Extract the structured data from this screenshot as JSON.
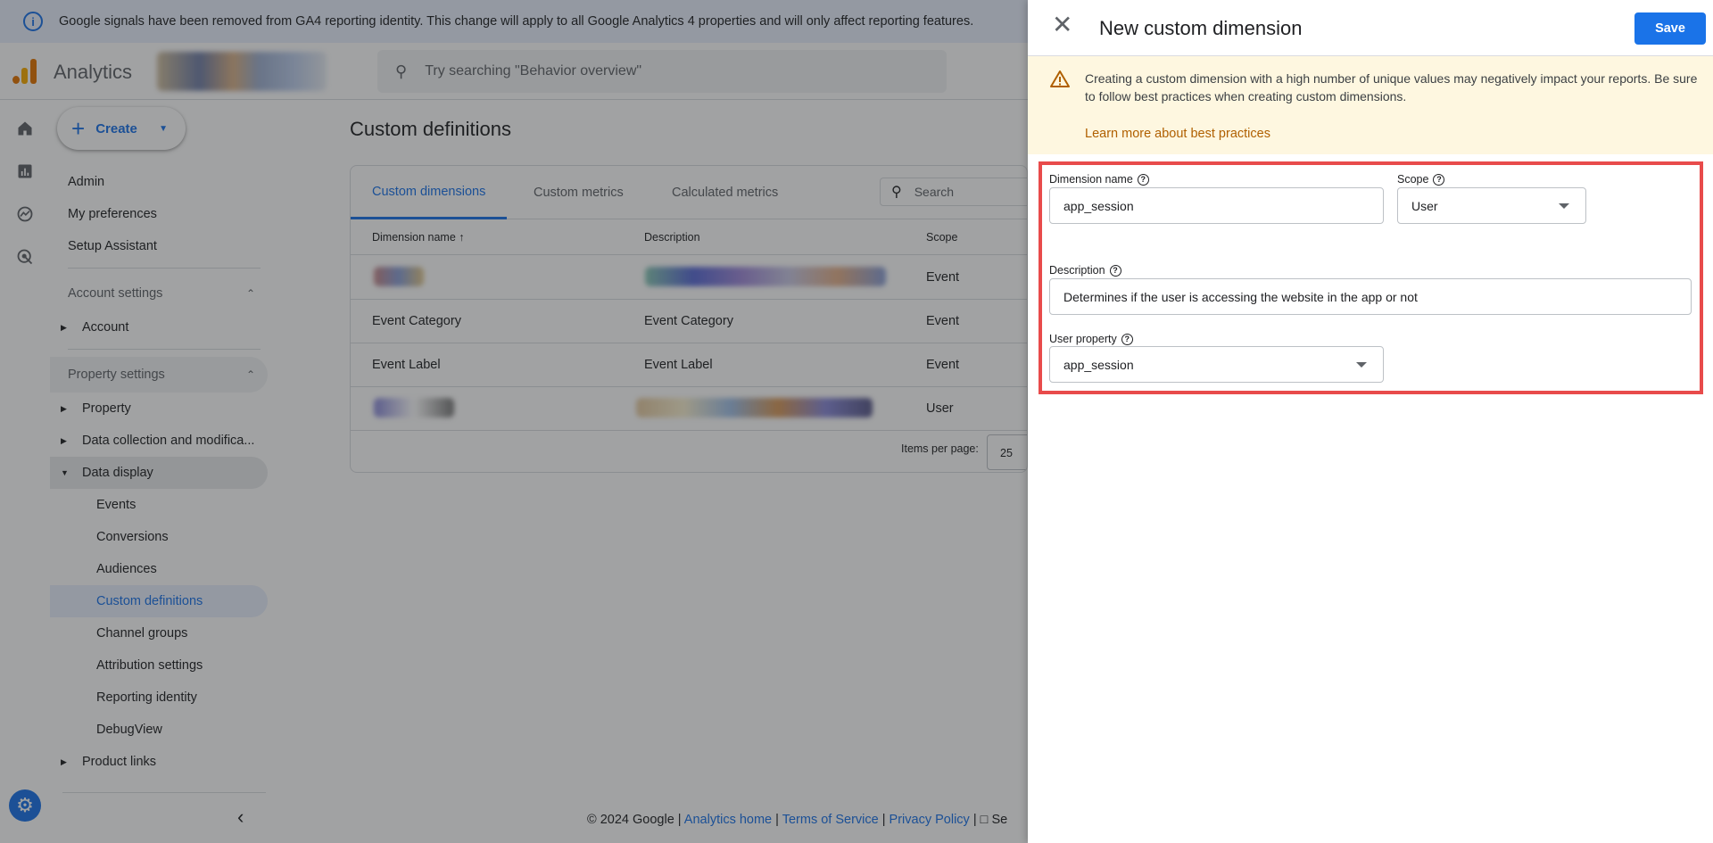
{
  "banner": {
    "text": "Google signals have been removed from GA4 reporting identity. This change will apply to all Google Analytics 4 properties and will only affect reporting features."
  },
  "topbar": {
    "app_name": "Analytics",
    "search_placeholder": "Try searching \"Behavior overview\""
  },
  "create_label": "Create",
  "nav": {
    "admin": "Admin",
    "my_preferences": "My preferences",
    "setup_assistant": "Setup Assistant",
    "account_settings": "Account settings",
    "account": "Account",
    "property_settings": "Property settings",
    "property": "Property",
    "data_collection": "Data collection and modifica...",
    "data_display": "Data display",
    "events": "Events",
    "conversions": "Conversions",
    "audiences": "Audiences",
    "custom_definitions": "Custom definitions",
    "channel_groups": "Channel groups",
    "attribution_settings": "Attribution settings",
    "reporting_identity": "Reporting identity",
    "debugview": "DebugView",
    "product_links": "Product links"
  },
  "main": {
    "title": "Custom definitions",
    "tabs": [
      "Custom dimensions",
      "Custom metrics",
      "Calculated metrics"
    ],
    "search_placeholder": "Search",
    "columns": [
      "Dimension name",
      "Description",
      "Scope"
    ],
    "rows": [
      {
        "name": "",
        "description": "",
        "scope": "Event"
      },
      {
        "name": "Event Category",
        "description": "Event Category",
        "scope": "Event"
      },
      {
        "name": "Event Label",
        "description": "Event Label",
        "scope": "Event"
      },
      {
        "name": "",
        "description": "",
        "scope": "User"
      }
    ],
    "items_per_page_label": "Items per page:",
    "items_per_page_value": "25"
  },
  "footer": {
    "copyright": "© 2024 Google |",
    "analytics_home": "Analytics home",
    "sep1": "|",
    "terms": "Terms of Service",
    "sep2": "|",
    "privacy": "Privacy Policy",
    "sep3": "|",
    "feedback": "Se"
  },
  "panel": {
    "title": "New custom dimension",
    "save_label": "Save",
    "warning_text": "Creating a custom dimension with a high number of unique values may negatively impact your reports. Be sure to follow best practices when creating custom dimensions.",
    "warning_link": "Learn more about best practices",
    "dimension_name_label": "Dimension name",
    "dimension_name_value": "app_session",
    "scope_label": "Scope",
    "scope_value": "User",
    "description_label": "Description",
    "description_value": "Determines if the user is accessing the website in the app or not",
    "user_property_label": "User property",
    "user_property_value": "app_session"
  },
  "colors": {
    "accent": "#1a73e8",
    "warning_bg": "#fef7e0",
    "highlight_border": "#e84b4b"
  }
}
